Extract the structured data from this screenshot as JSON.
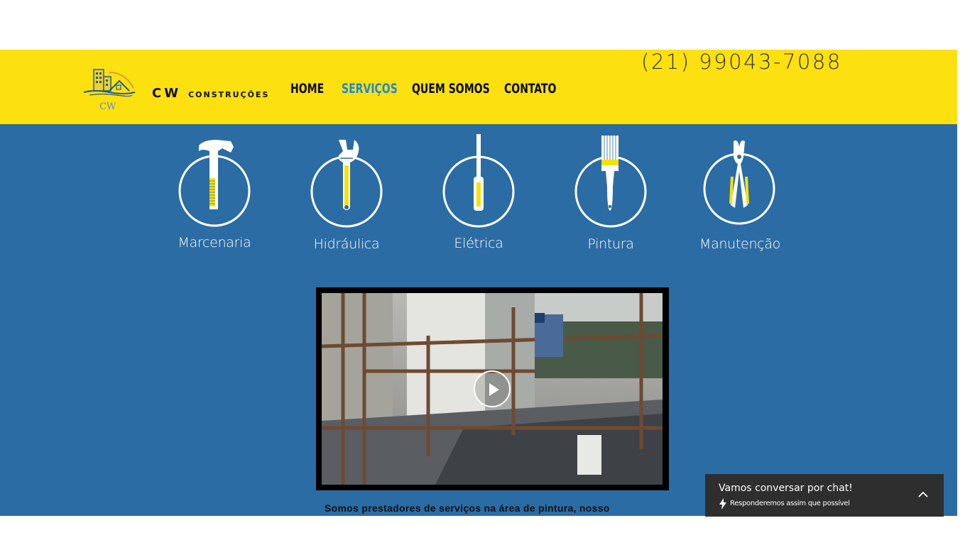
{
  "header": {
    "brand_name": "CW",
    "brand_sub": "CONSTRUÇÕES",
    "logo_text": "CW",
    "phone": "(21) 99043-7088",
    "nav": [
      {
        "label": "HOME"
      },
      {
        "label": "SERVIÇOS",
        "active": true
      },
      {
        "label": "QUEM SOMOS"
      },
      {
        "label": "CONTATO"
      }
    ]
  },
  "services": [
    {
      "label": "Marcenaria",
      "icon": "hammer-icon"
    },
    {
      "label": "Hidráulica",
      "icon": "wrench-icon"
    },
    {
      "label": "Elétrica",
      "icon": "screwdriver-icon"
    },
    {
      "label": "Pintura",
      "icon": "paintbrush-icon"
    },
    {
      "label": "Manutenção",
      "icon": "pliers-icon"
    }
  ],
  "content": {
    "description": "Somos prestadores de serviços na área de pintura, nosso"
  },
  "chat": {
    "title": "Vamos conversar por chat!",
    "subtitle": "Responderemos assim que possível"
  },
  "colors": {
    "header_bg": "#fde010",
    "main_bg": "#2c6ca4",
    "nav_active": "#1f87d8",
    "accent_yellow": "#f6e10e",
    "chat_bg": "#2e2e2e"
  }
}
